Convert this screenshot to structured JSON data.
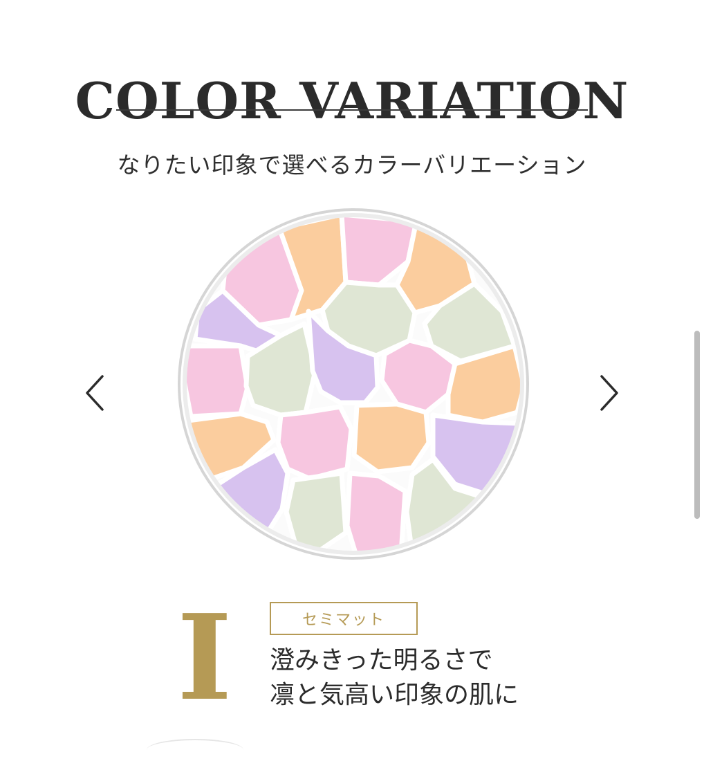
{
  "header": {
    "title": "COLOR VARIATION",
    "subtitle": "なりたい印象で選べるカラーバリエーション"
  },
  "carousel": {
    "prev_icon": "chevron-left-icon",
    "next_icon": "chevron-right-icon",
    "image_icon": "powder-compact-mosaic",
    "colors": {
      "pink": "#f7c6e0",
      "orange": "#fbcd9e",
      "green": "#dfe6d4",
      "lavender": "#d7c2ef",
      "rim": "#d9d9d9"
    }
  },
  "variant": {
    "numeral": "I",
    "finish": "セミマット",
    "description_line1": "澄みきった明るさで",
    "description_line2": "凛と気高い印象の肌に",
    "accent_color": "#b59a55"
  }
}
